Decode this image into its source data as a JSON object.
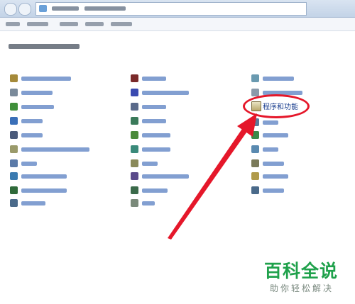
{
  "window": {
    "title_text": "",
    "accent_color": "#c3d3e7"
  },
  "control_panel": {
    "highlighted_item_label": "程序和功能",
    "highlighted_item_icon": "programs-and-features-icon"
  },
  "annotation": {
    "shape": "ellipse",
    "arrow_color": "#e5172a"
  },
  "watermark": {
    "main": "百科全说",
    "sub": "助你轻松解决",
    "color": "#1fa14b"
  }
}
